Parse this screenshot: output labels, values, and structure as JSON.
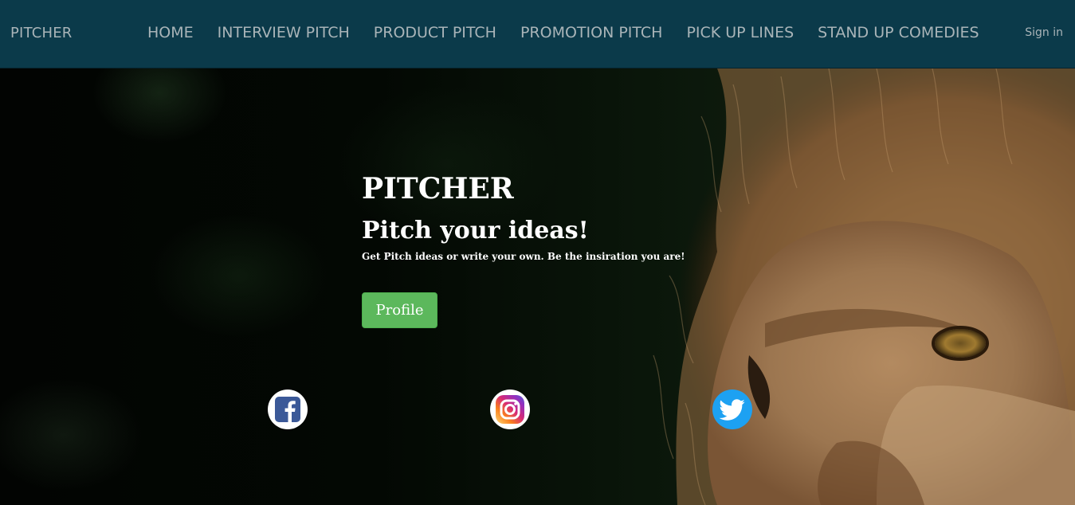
{
  "navbar": {
    "brand": "PITCHER",
    "links": [
      {
        "label": "HOME"
      },
      {
        "label": "INTERVIEW PITCH"
      },
      {
        "label": "PRODUCT PITCH"
      },
      {
        "label": "PROMOTION PITCH"
      },
      {
        "label": "PICK UP LINES"
      },
      {
        "label": "STAND UP COMEDIES"
      }
    ],
    "signin": "Sign in"
  },
  "hero": {
    "title": "PITCHER",
    "subtitle": "Pitch your ideas!",
    "text": "Get Pitch ideas or write your own. Be the insiration you are!",
    "button": "Profile"
  },
  "social": [
    {
      "icon": "facebook-icon",
      "color": "#3b5998"
    },
    {
      "icon": "instagram-icon",
      "color": "#c13584"
    },
    {
      "icon": "twitter-icon",
      "color": "#1da1f2"
    }
  ],
  "colors": {
    "navbar_bg": "#0b3a4a",
    "nav_text": "#a9b4b8",
    "button_green": "#5cb85c"
  }
}
